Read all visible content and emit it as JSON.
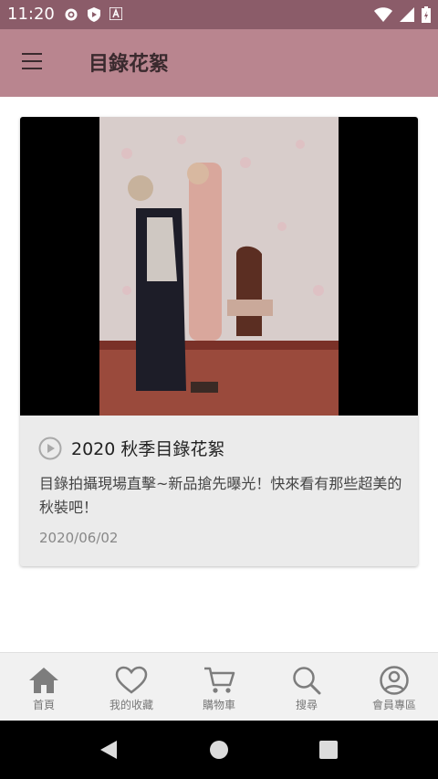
{
  "status_bar": {
    "time": "11:20"
  },
  "app_bar": {
    "title": "目錄花絮"
  },
  "card": {
    "title": "2020 秋季目錄花絮",
    "description": "目錄拍攝現場直擊~新品搶先曝光！快來看有那些超美的秋裝吧！",
    "date": "2020/06/02"
  },
  "bottom_nav": {
    "items": [
      {
        "label": "首頁",
        "icon": "home-icon",
        "active": true
      },
      {
        "label": "我的收藏",
        "icon": "heart-icon"
      },
      {
        "label": "購物車",
        "icon": "cart-icon"
      },
      {
        "label": "搜尋",
        "icon": "search-icon"
      },
      {
        "label": "會員專區",
        "icon": "account-icon"
      }
    ]
  },
  "colors": {
    "status_bar": "#8b5c69",
    "app_bar": "#b9858f",
    "card_bg": "#ebebeb",
    "nav_bg": "#f1f1f1"
  }
}
